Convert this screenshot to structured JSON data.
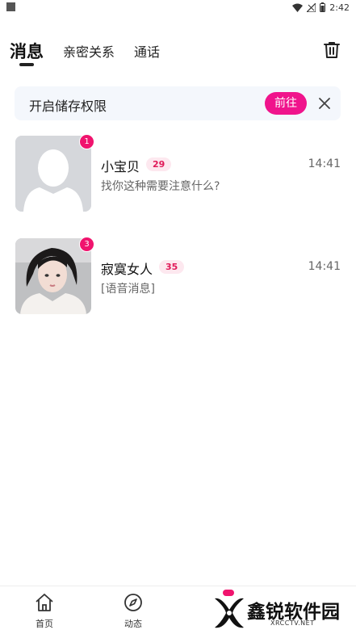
{
  "status_bar": {
    "time": "2:42"
  },
  "tabs": [
    {
      "label": "消息",
      "active": true
    },
    {
      "label": "亲密关系",
      "active": false
    },
    {
      "label": "通话",
      "active": false
    }
  ],
  "banner": {
    "text": "开启储存权限",
    "button_label": "前往"
  },
  "conversations": [
    {
      "name": "小宝贝",
      "age": "29",
      "time": "14:41",
      "message": "找你这种需要注意什么?",
      "unread": "1"
    },
    {
      "name": "寂寞女人",
      "age": "35",
      "time": "14:41",
      "message": "[语音消息]",
      "unread": "3"
    }
  ],
  "bottom_nav": [
    {
      "label": "首页",
      "icon": "home-icon"
    },
    {
      "label": "动态",
      "icon": "compass-icon"
    }
  ],
  "watermark": {
    "text": "鑫锐软件园",
    "sub": "XRCCTV.NET"
  },
  "colors": {
    "accent": "#f0148c",
    "badge": "#f0146e",
    "banner_bg": "#f4f7fc"
  }
}
